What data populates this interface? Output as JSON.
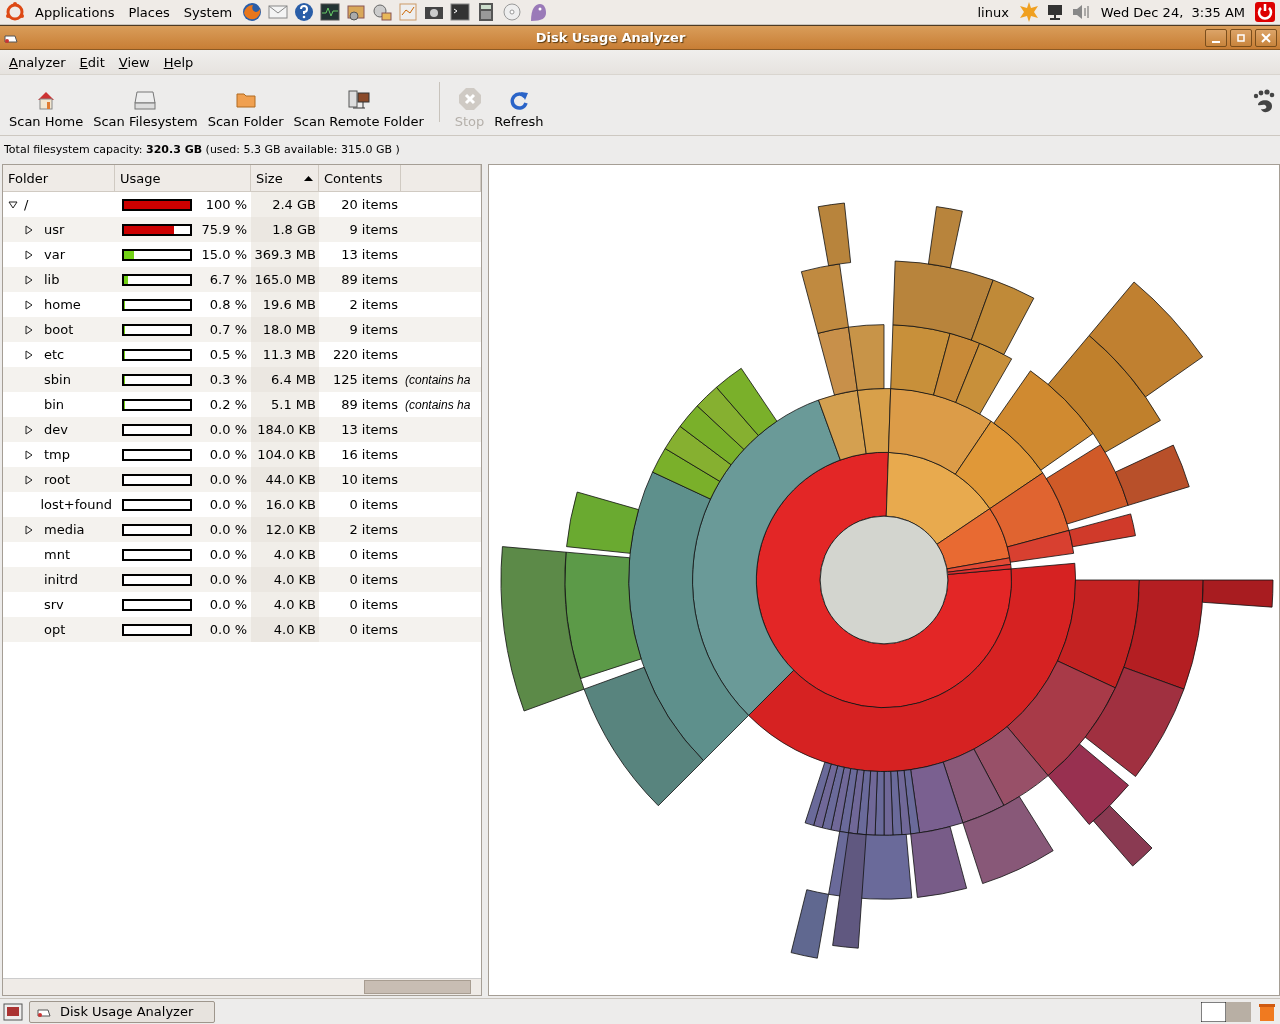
{
  "top_panel": {
    "menus": [
      "Applications",
      "Places",
      "System"
    ],
    "user": "linux",
    "clock": "Wed Dec 24,  3:35 AM"
  },
  "window": {
    "title": "Disk Usage Analyzer"
  },
  "menu_bar": [
    "Analyzer",
    "Edit",
    "View",
    "Help"
  ],
  "toolbar": [
    {
      "label": "Scan Home",
      "disabled": false
    },
    {
      "label": "Scan Filesystem",
      "disabled": false
    },
    {
      "label": "Scan Folder",
      "disabled": false
    },
    {
      "label": "Scan Remote Folder",
      "disabled": false
    },
    {
      "label": "Stop",
      "disabled": true
    },
    {
      "label": "Refresh",
      "disabled": false
    }
  ],
  "capacity": "Total filesystem capacity: **320.3 GB** (used: 5.3 GB available: 315.0 GB )",
  "table": {
    "columns": [
      {
        "label": "Folder",
        "sorted": false
      },
      {
        "label": "Usage",
        "sorted": false
      },
      {
        "label": "Size",
        "sorted": true
      },
      {
        "label": "Contents",
        "sorted": false
      }
    ],
    "rows": [
      {
        "name": "/",
        "expanded": true,
        "level": 1.0,
        "color": "#cc0000",
        "percent": "100 %",
        "size": "2.4 GB",
        "contents": "20 items",
        "children": [
          {
            "name": "usr",
            "expanded": false,
            "level": 0.759,
            "color": "#cc0000",
            "percent": "75.9 %",
            "size": "1.8 GB",
            "contents": "9 items"
          },
          {
            "name": "var",
            "expanded": false,
            "level": 0.15,
            "color": "#73d216",
            "percent": "15.0 %",
            "size": "369.3 MB",
            "contents": "13 items"
          },
          {
            "name": "lib",
            "expanded": false,
            "level": 0.067,
            "color": "#73d216",
            "percent": "6.7 %",
            "size": "165.0 MB",
            "contents": "89 items"
          },
          {
            "name": "home",
            "expanded": false,
            "level": 0.008,
            "color": "#73d216",
            "percent": "0.8 %",
            "size": "19.6 MB",
            "contents": "2 items"
          },
          {
            "name": "boot",
            "expanded": false,
            "level": 0.007,
            "color": "#73d216",
            "percent": "0.7 %",
            "size": "18.0 MB",
            "contents": "9 items"
          },
          {
            "name": "etc",
            "expanded": false,
            "level": 0.005,
            "color": "#73d216",
            "percent": "0.5 %",
            "size": "11.3 MB",
            "contents": "220 items"
          },
          {
            "name": "sbin",
            "level": 0.003,
            "color": "#73d216",
            "percent": "0.3 %",
            "size": "6.4 MB",
            "contents": "125 items",
            "note": "(contains ha"
          },
          {
            "name": "bin",
            "level": 0.002,
            "color": "#73d216",
            "percent": "0.2 %",
            "size": "5.1 MB",
            "contents": "89 items",
            "note": "(contains ha"
          },
          {
            "name": "dev",
            "expanded": false,
            "percent": "0.0 %",
            "size": "184.0 KB",
            "contents": "13 items"
          },
          {
            "name": "tmp",
            "expanded": false,
            "percent": "0.0 %",
            "size": "104.0 KB",
            "contents": "16 items"
          },
          {
            "name": "root",
            "expanded": false,
            "percent": "0.0 %",
            "size": "44.0 KB",
            "contents": "10 items"
          },
          {
            "name": "lost+found",
            "percent": "0.0 %",
            "size": "16.0 KB",
            "contents": "0 items"
          },
          {
            "name": "media",
            "expanded": false,
            "percent": "0.0 %",
            "size": "12.0 KB",
            "contents": "2 items"
          },
          {
            "name": "mnt",
            "percent": "0.0 %",
            "size": "4.0 KB",
            "contents": "0 items"
          },
          {
            "name": "initrd",
            "percent": "0.0 %",
            "size": "4.0 KB",
            "contents": "0 items"
          },
          {
            "name": "srv",
            "percent": "0.0 %",
            "size": "4.0 KB",
            "contents": "0 items"
          },
          {
            "name": "opt",
            "percent": "0.0 %",
            "size": "4.0 KB",
            "contents": "0 items"
          }
        ]
      }
    ]
  },
  "taskbar": {
    "tasks": [
      {
        "label": "Disk Usage Analyzer",
        "selected": false
      }
    ]
  }
}
